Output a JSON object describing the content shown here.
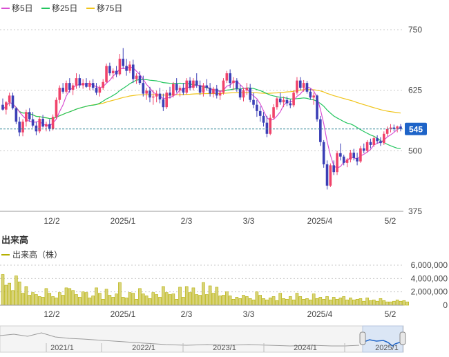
{
  "main_legend": [
    {
      "label": "移5日",
      "color": "#d84fd2"
    },
    {
      "label": "移25日",
      "color": "#22c55e"
    },
    {
      "label": "移75日",
      "color": "#f0c419"
    }
  ],
  "volume_title": "出来高",
  "volume_legend": {
    "label": "出来高（株）",
    "color": "#b5b000"
  },
  "price_badge": "545",
  "navigator_labels": [
    "2021/1",
    "2022/1",
    "2023/1",
    "2024/1",
    "2025/1"
  ],
  "colors": {
    "up": "#f0436a",
    "down": "#3b3fb6",
    "grid": "#c8c8c8",
    "price_line": "#3a8b9b",
    "badge": "#1e64c8",
    "volume": "#b5b000"
  },
  "chart_data": {
    "type": "candlestick",
    "price_axis": {
      "ticks": [
        750,
        625,
        500,
        375
      ],
      "ylim": [
        375,
        750
      ]
    },
    "volume_axis": {
      "ticks": [
        "6,000,000",
        "4,000,000",
        "2,000,000",
        "0"
      ],
      "ylim": [
        0,
        6000000
      ]
    },
    "x_tick_labels": [
      "12/2",
      "2025/1",
      "2/3",
      "3/3",
      "2025/4",
      "5/2"
    ],
    "last_price": 545,
    "candles": [
      [
        595,
        608,
        583,
        585
      ],
      [
        585,
        603,
        575,
        600
      ],
      [
        600,
        620,
        592,
        614
      ],
      [
        614,
        620,
        585,
        588
      ],
      [
        588,
        590,
        555,
        560
      ],
      [
        560,
        570,
        530,
        538
      ],
      [
        538,
        565,
        530,
        560
      ],
      [
        560,
        585,
        550,
        580
      ],
      [
        580,
        588,
        560,
        565
      ],
      [
        565,
        580,
        548,
        552
      ],
      [
        552,
        560,
        532,
        540
      ],
      [
        540,
        570,
        536,
        566
      ],
      [
        566,
        574,
        548,
        550
      ],
      [
        550,
        560,
        540,
        555
      ],
      [
        555,
        565,
        540,
        545
      ],
      [
        545,
        575,
        542,
        570
      ],
      [
        570,
        610,
        566,
        605
      ],
      [
        605,
        635,
        598,
        630
      ],
      [
        630,
        640,
        618,
        622
      ],
      [
        622,
        645,
        618,
        640
      ],
      [
        640,
        650,
        620,
        626
      ],
      [
        626,
        640,
        615,
        635
      ],
      [
        635,
        660,
        628,
        650
      ],
      [
        650,
        658,
        630,
        635
      ],
      [
        635,
        648,
        628,
        640
      ],
      [
        640,
        650,
        630,
        632
      ],
      [
        632,
        645,
        625,
        640
      ],
      [
        640,
        648,
        625,
        630
      ],
      [
        630,
        640,
        615,
        620
      ],
      [
        620,
        635,
        612,
        630
      ],
      [
        630,
        648,
        626,
        642
      ],
      [
        642,
        680,
        640,
        675
      ],
      [
        675,
        682,
        655,
        660
      ],
      [
        660,
        670,
        648,
        665
      ],
      [
        665,
        675,
        652,
        658
      ],
      [
        658,
        700,
        655,
        690
      ],
      [
        690,
        712,
        670,
        675
      ],
      [
        675,
        690,
        655,
        665
      ],
      [
        665,
        685,
        660,
        678
      ],
      [
        678,
        688,
        640,
        648
      ],
      [
        648,
        660,
        638,
        655
      ],
      [
        655,
        664,
        636,
        640
      ],
      [
        640,
        655,
        612,
        618
      ],
      [
        618,
        630,
        605,
        624
      ],
      [
        624,
        632,
        600,
        610
      ],
      [
        610,
        625,
        595,
        612
      ],
      [
        612,
        624,
        600,
        618
      ],
      [
        618,
        630,
        598,
        606
      ],
      [
        606,
        618,
        582,
        590
      ],
      [
        590,
        625,
        586,
        620
      ],
      [
        620,
        632,
        608,
        614
      ],
      [
        614,
        642,
        610,
        638
      ],
      [
        638,
        650,
        620,
        625
      ],
      [
        625,
        635,
        612,
        630
      ],
      [
        630,
        640,
        615,
        620
      ],
      [
        620,
        650,
        616,
        645
      ],
      [
        645,
        652,
        625,
        630
      ],
      [
        630,
        650,
        625,
        645
      ],
      [
        645,
        660,
        630,
        635
      ],
      [
        635,
        645,
        615,
        620
      ],
      [
        620,
        640,
        612,
        635
      ],
      [
        635,
        648,
        624,
        630
      ],
      [
        630,
        640,
        612,
        618
      ],
      [
        618,
        632,
        610,
        628
      ],
      [
        628,
        636,
        608,
        614
      ],
      [
        614,
        626,
        605,
        620
      ],
      [
        620,
        650,
        616,
        645
      ],
      [
        645,
        665,
        640,
        660
      ],
      [
        660,
        668,
        630,
        640
      ],
      [
        640,
        652,
        625,
        645
      ],
      [
        645,
        650,
        622,
        628
      ],
      [
        628,
        636,
        605,
        610
      ],
      [
        610,
        630,
        602,
        625
      ],
      [
        625,
        640,
        615,
        630
      ],
      [
        630,
        638,
        600,
        605
      ],
      [
        605,
        620,
        588,
        595
      ],
      [
        595,
        605,
        570,
        582
      ],
      [
        582,
        592,
        560,
        572
      ],
      [
        572,
        580,
        550,
        558
      ],
      [
        558,
        572,
        528,
        535
      ],
      [
        535,
        575,
        532,
        568
      ],
      [
        568,
        596,
        565,
        590
      ],
      [
        590,
        612,
        585,
        608
      ],
      [
        608,
        620,
        595,
        600
      ],
      [
        600,
        612,
        590,
        605
      ],
      [
        605,
        612,
        592,
        598
      ],
      [
        598,
        606,
        588,
        594
      ],
      [
        594,
        625,
        590,
        620
      ],
      [
        620,
        652,
        616,
        645
      ],
      [
        645,
        652,
        625,
        630
      ],
      [
        630,
        646,
        622,
        640
      ],
      [
        640,
        644,
        618,
        622
      ],
      [
        622,
        628,
        605,
        610
      ],
      [
        610,
        620,
        595,
        614
      ],
      [
        614,
        616,
        560,
        565
      ],
      [
        565,
        572,
        510,
        518
      ],
      [
        518,
        522,
        465,
        472
      ],
      [
        472,
        480,
        420,
        428
      ],
      [
        428,
        474,
        425,
        470
      ],
      [
        470,
        480,
        450,
        456
      ],
      [
        456,
        500,
        450,
        495
      ],
      [
        495,
        515,
        480,
        488
      ],
      [
        488,
        492,
        470,
        475
      ],
      [
        475,
        485,
        466,
        482
      ],
      [
        482,
        502,
        476,
        496
      ],
      [
        496,
        504,
        480,
        485
      ],
      [
        485,
        496,
        470,
        478
      ],
      [
        478,
        510,
        475,
        505
      ],
      [
        505,
        515,
        495,
        500
      ],
      [
        500,
        522,
        496,
        518
      ],
      [
        518,
        525,
        505,
        512
      ],
      [
        512,
        530,
        508,
        526
      ],
      [
        526,
        532,
        515,
        520
      ],
      [
        520,
        528,
        510,
        516
      ],
      [
        516,
        540,
        512,
        535
      ],
      [
        535,
        550,
        530,
        545
      ],
      [
        545,
        555,
        538,
        548
      ],
      [
        548,
        554,
        540,
        545
      ],
      [
        545,
        552,
        538,
        550
      ],
      [
        550,
        555,
        540,
        545
      ]
    ],
    "volume": [
      4600000,
      3000000,
      3300000,
      2200000,
      4400000,
      3500000,
      1800000,
      2800000,
      1500000,
      1900000,
      1600000,
      1300000,
      1200000,
      2500000,
      1800000,
      1300000,
      1100000,
      1900000,
      1500000,
      2600000,
      2500000,
      2200000,
      1600000,
      1200000,
      2000000,
      1900000,
      1100000,
      1400000,
      2600000,
      1800000,
      900000,
      2400000,
      1500000,
      1200000,
      1700000,
      3400000,
      1200000,
      1100000,
      1900000,
      1800000,
      900000,
      2500000,
      1700000,
      1400000,
      1000000,
      1900000,
      1600000,
      1200000,
      2800000,
      1900000,
      1600000,
      1700000,
      900000,
      2700000,
      1200000,
      2800000,
      1900000,
      2600000,
      1600000,
      1500000,
      3400000,
      1600000,
      2900000,
      1800000,
      2700000,
      1400000,
      1500000,
      2000000,
      1400000,
      900000,
      1200000,
      1000000,
      1500000,
      1300000,
      1000000,
      800000,
      2000000,
      1500000,
      1000000,
      800000,
      1100000,
      1300000,
      700000,
      1800000,
      1000000,
      900000,
      1300000,
      800000,
      1800000,
      1300000,
      900000,
      1000000,
      800000,
      1700000,
      1000000,
      1200000,
      900000,
      1300000,
      800000,
      1200000,
      900000,
      1100000,
      1300000,
      800000,
      1100000,
      800000,
      900000,
      1000000,
      600000,
      1100000,
      700000,
      800000,
      600000,
      1000000,
      700000,
      500000,
      500000,
      600000,
      800000,
      600000,
      700000,
      500000
    ],
    "ma5": [],
    "ma25": [],
    "ma75": []
  }
}
